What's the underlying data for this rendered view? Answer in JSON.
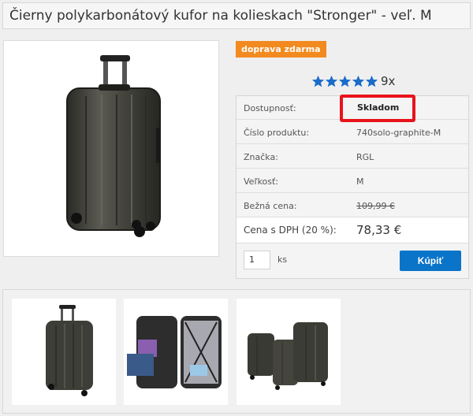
{
  "product": {
    "title": "Čierny polykarbonátový kufor na kolieskach \"Stronger\" - veľ. M",
    "badge": "doprava zdarma",
    "rating_count": "9x",
    "stars": 5
  },
  "details": [
    {
      "label": "Dostupnosť:",
      "value": "Skladom"
    },
    {
      "label": "Číslo produktu:",
      "value": "740solo-graphite-M"
    },
    {
      "label": "Značka:",
      "value": "RGL"
    },
    {
      "label": "Veľkosť:",
      "value": "M"
    },
    {
      "label": "Bežná cena:",
      "value": "109,99 €"
    }
  ],
  "price": {
    "label": "Cena s DPH (20 %):",
    "value": "78,33 €"
  },
  "purchase": {
    "quantity": "1",
    "unit": "ks",
    "buy_label": "Kúpiť"
  },
  "colors": {
    "accent": "#0a74c9",
    "badge": "#f28a1f",
    "highlight": "#e8141c"
  },
  "thumbnails": [
    {
      "name": "suitcase-front-thumbnail"
    },
    {
      "name": "suitcase-open-thumbnail"
    },
    {
      "name": "suitcase-set-thumbnail"
    }
  ]
}
